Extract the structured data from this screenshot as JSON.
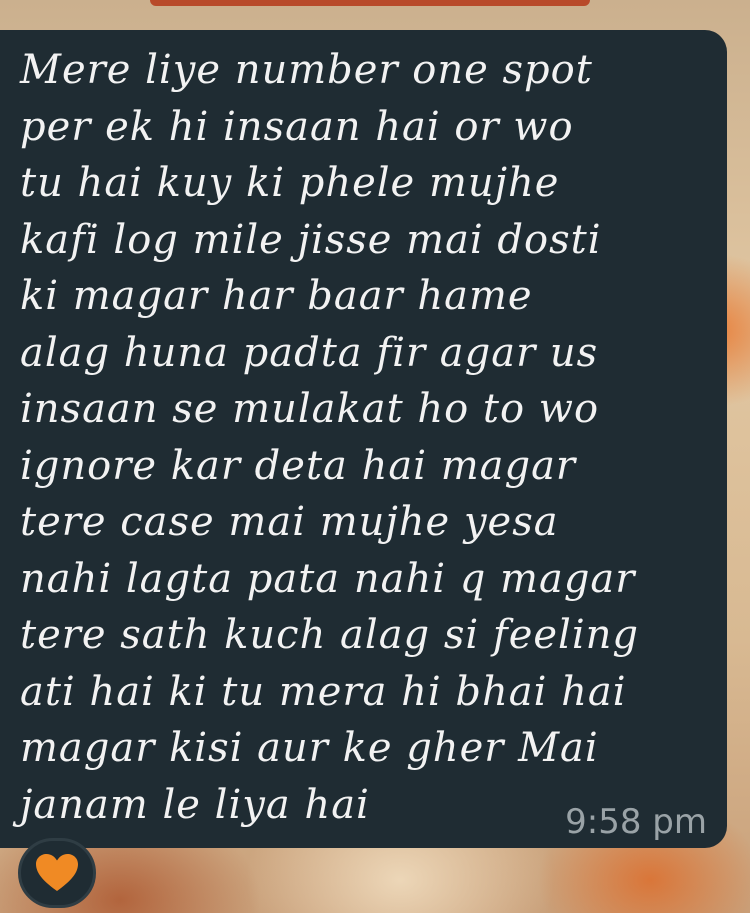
{
  "message": {
    "lines": [
      "Mere liye number one spot",
      "per ek hi insaan hai or wo",
      "tu hai kuy ki phele mujhe",
      "kafi log mile jisse mai dosti",
      "ki magar har baar hame",
      "alag huna padta fir agar us",
      "insaan se mulakat ho to wo",
      "ignore kar deta hai magar",
      "tere case mai mujhe yesa",
      "nahi lagta pata nahi q magar",
      "tere sath kuch alag si feeling",
      "ati hai ki tu mera hi  bhai hai",
      "magar kisi aur ke gher Mai",
      "janam le liya hai"
    ],
    "timestamp": "9:58 pm"
  },
  "reaction": {
    "icon": "orange-heart-icon",
    "color": "#f08a24"
  },
  "colors": {
    "bubble": "#1f2c33",
    "text": "#f2f2f2",
    "timestamp": "#9aa3a7"
  }
}
